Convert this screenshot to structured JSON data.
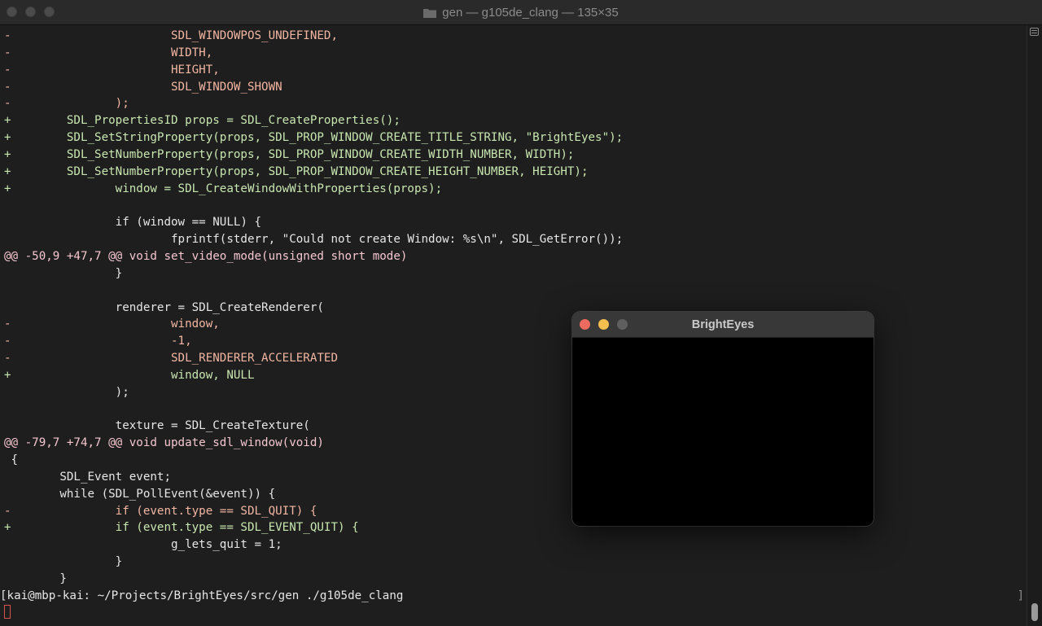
{
  "window": {
    "title": "gen — g105de_clang — 135×35",
    "folder_icon": "folder-icon"
  },
  "terminal": {
    "lines": [
      {
        "kind": "del",
        "text": "-                       SDL_WINDOWPOS_UNDEFINED,"
      },
      {
        "kind": "del",
        "text": "-                       WIDTH,"
      },
      {
        "kind": "del",
        "text": "-                       HEIGHT,"
      },
      {
        "kind": "del",
        "text": "-                       SDL_WINDOW_SHOWN"
      },
      {
        "kind": "del",
        "text": "-               );"
      },
      {
        "kind": "add",
        "text": "+        SDL_PropertiesID props = SDL_CreateProperties();"
      },
      {
        "kind": "add",
        "text": "+        SDL_SetStringProperty(props, SDL_PROP_WINDOW_CREATE_TITLE_STRING, \"BrightEyes\");"
      },
      {
        "kind": "add",
        "text": "+        SDL_SetNumberProperty(props, SDL_PROP_WINDOW_CREATE_WIDTH_NUMBER, WIDTH);"
      },
      {
        "kind": "add",
        "text": "+        SDL_SetNumberProperty(props, SDL_PROP_WINDOW_CREATE_HEIGHT_NUMBER, HEIGHT);"
      },
      {
        "kind": "add",
        "text": "+               window = SDL_CreateWindowWithProperties(props);"
      },
      {
        "kind": "ctx",
        "text": ""
      },
      {
        "kind": "ctx",
        "text": "                if (window == NULL) {"
      },
      {
        "kind": "ctx",
        "text": "                        fprintf(stderr, \"Could not create Window: %s\\n\", SDL_GetError());"
      },
      {
        "kind": "hunk",
        "text": "@@ -50,9 +47,7 @@ void set_video_mode(unsigned short mode)"
      },
      {
        "kind": "ctx",
        "text": "                }"
      },
      {
        "kind": "ctx",
        "text": ""
      },
      {
        "kind": "ctx",
        "text": "                renderer = SDL_CreateRenderer("
      },
      {
        "kind": "del",
        "text": "-                       window,"
      },
      {
        "kind": "del",
        "text": "-                       -1,"
      },
      {
        "kind": "del",
        "text": "-                       SDL_RENDERER_ACCELERATED"
      },
      {
        "kind": "add",
        "text": "+                       window, NULL"
      },
      {
        "kind": "ctx",
        "text": "                );"
      },
      {
        "kind": "ctx",
        "text": ""
      },
      {
        "kind": "ctx",
        "text": "                texture = SDL_CreateTexture("
      },
      {
        "kind": "hunk",
        "text": "@@ -79,7 +74,7 @@ void update_sdl_window(void)"
      },
      {
        "kind": "ctx",
        "text": " {"
      },
      {
        "kind": "ctx",
        "text": "        SDL_Event event;"
      },
      {
        "kind": "ctx",
        "text": "        while (SDL_PollEvent(&event)) {"
      },
      {
        "kind": "del",
        "text": "-               if (event.type == SDL_QUIT) {"
      },
      {
        "kind": "add",
        "text": "+               if (event.type == SDL_EVENT_QUIT) {"
      },
      {
        "kind": "ctx",
        "text": "                        g_lets_quit = 1;"
      },
      {
        "kind": "ctx",
        "text": "                }"
      },
      {
        "kind": "ctx",
        "text": "        }"
      }
    ],
    "prompt": "[kai@mbp-kai: ~/Projects/BrightEyes/src/gen ./g105de_clang",
    "prompt_right": "]"
  },
  "popup": {
    "title": "BrightEyes"
  },
  "colors": {
    "background": "#1e1e1e",
    "deleted": "#f2b6a2",
    "added": "#c8e6b0",
    "hunk": "#f4c7cf",
    "close": "#ed6a5e",
    "minimize": "#f5bf4f"
  }
}
